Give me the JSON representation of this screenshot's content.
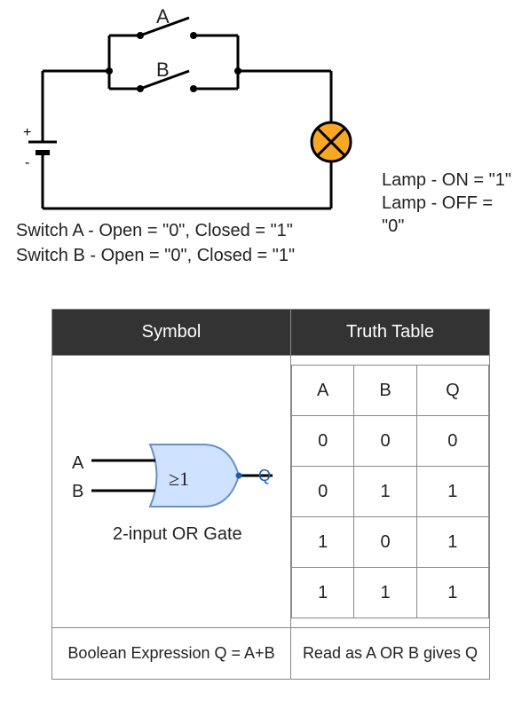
{
  "circuit": {
    "switchA_label": "A",
    "switchB_label": "B",
    "lamp_on": "Lamp - ON = \"1\"",
    "lamp_off": "Lamp - OFF = \"0\"",
    "legend_a": "Switch A - Open = \"0\", Closed = \"1\"",
    "legend_b": "Switch B - Open = \"0\", Closed = \"1\""
  },
  "table": {
    "header_symbol": "Symbol",
    "header_truth": "Truth Table",
    "gate_inputA": "A",
    "gate_inputB": "B",
    "gate_ge1": "≥1",
    "gate_outputQ": "Q",
    "gate_caption": "2-input OR Gate",
    "tt_headers": {
      "a": "A",
      "b": "B",
      "q": "Q"
    },
    "rows": [
      {
        "a": "0",
        "b": "0",
        "q": "0"
      },
      {
        "a": "0",
        "b": "1",
        "q": "1"
      },
      {
        "a": "1",
        "b": "0",
        "q": "1"
      },
      {
        "a": "1",
        "b": "1",
        "q": "1"
      }
    ],
    "boolean_expr": "Boolean Expression Q = A+B",
    "read_as": "Read as A OR B gives Q"
  },
  "chart_data": {
    "type": "table",
    "title": "2-input OR Gate Truth Table",
    "columns": [
      "A",
      "B",
      "Q"
    ],
    "rows": [
      [
        0,
        0,
        0
      ],
      [
        0,
        1,
        1
      ],
      [
        1,
        0,
        1
      ],
      [
        1,
        1,
        1
      ]
    ],
    "boolean_expression": "Q = A + B",
    "gate_symbol_label": "≥1"
  }
}
